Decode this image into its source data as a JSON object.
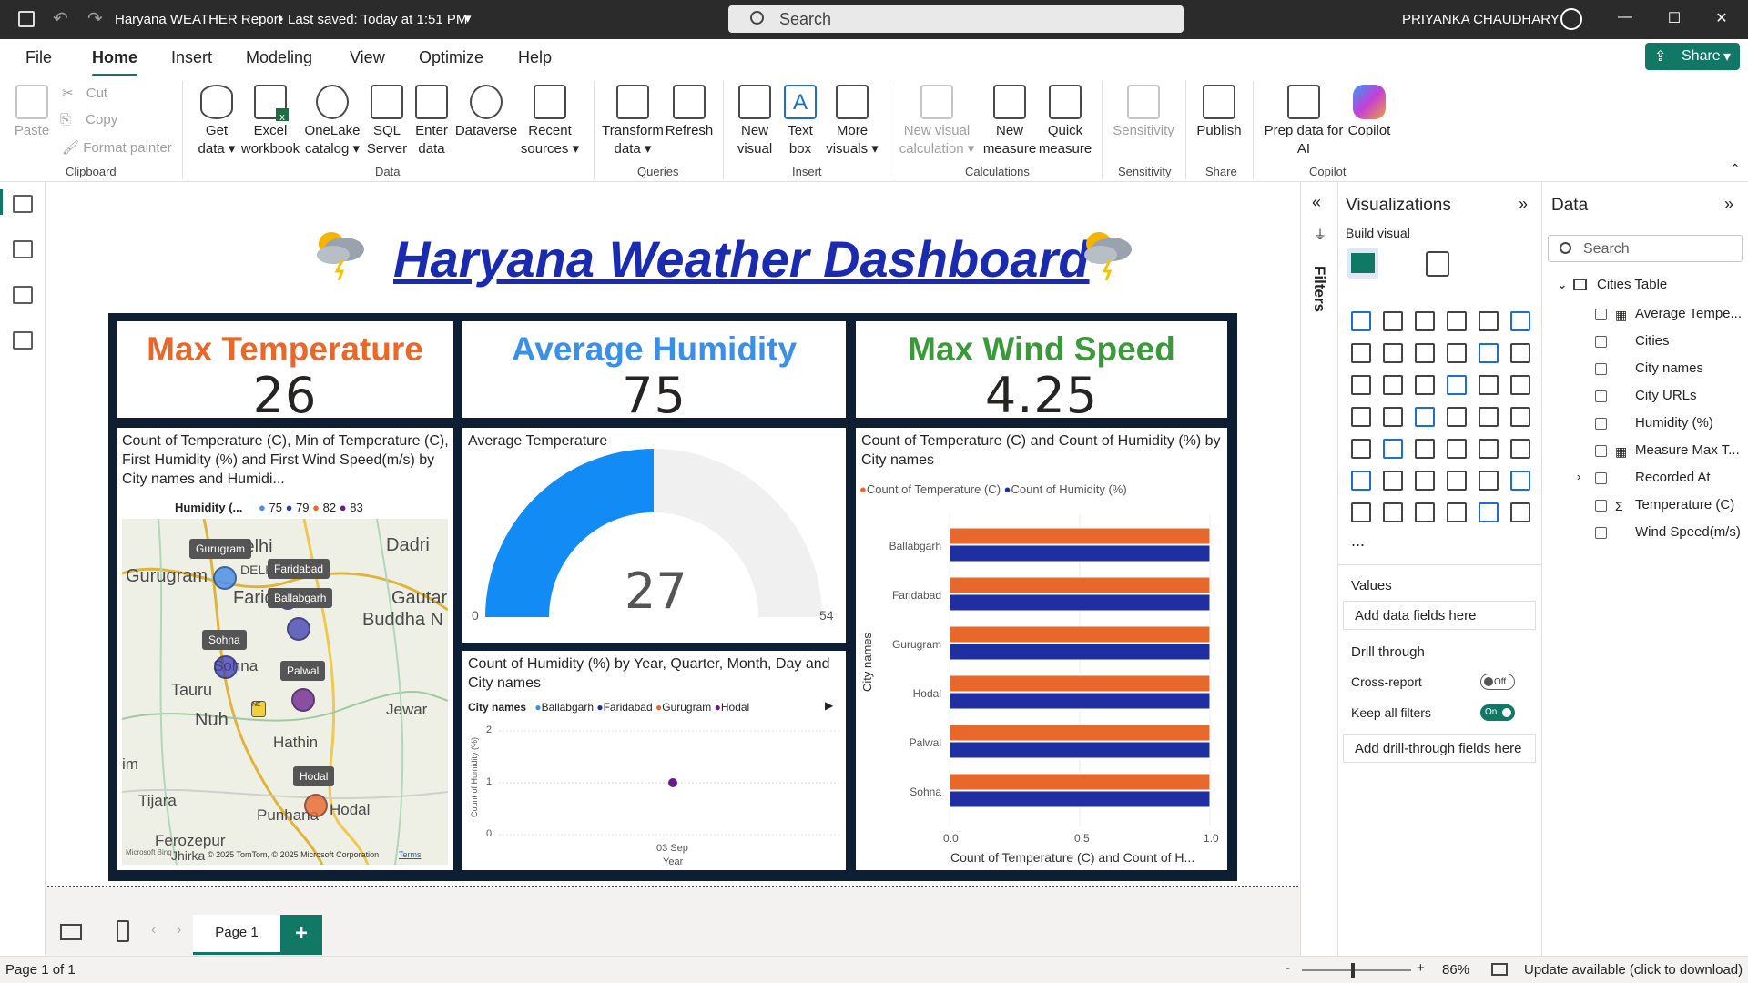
{
  "titlebar": {
    "title": "Haryana WEATHER Report",
    "saved": "Last saved: Today at 1:51 PM",
    "search": "Search",
    "user": "PRIYANKA CHAUDHARY"
  },
  "menu": [
    "File",
    "Home",
    "Insert",
    "Modeling",
    "View",
    "Optimize",
    "Help"
  ],
  "share": "Share",
  "ribbon": {
    "clipboard": {
      "paste": "Paste",
      "cut": "Cut",
      "copy": "Copy",
      "format": "Format painter",
      "group": "Clipboard"
    },
    "data": {
      "get1": "Get",
      "get2": "data",
      "excel1": "Excel",
      "excel2": "workbook",
      "onelake1": "OneLake",
      "onelake2": "catalog",
      "sql1": "SQL",
      "sql2": "Server",
      "enter1": "Enter",
      "enter2": "data",
      "dataverse": "Dataverse",
      "recent1": "Recent",
      "recent2": "sources",
      "group": "Data"
    },
    "queries": {
      "transform1": "Transform",
      "transform2": "data",
      "refresh": "Refresh",
      "group": "Queries"
    },
    "insert": {
      "newvisual1": "New",
      "newvisual2": "visual",
      "text1": "Text",
      "text2": "box",
      "more1": "More",
      "more2": "visuals",
      "group": "Insert"
    },
    "calc": {
      "nvc1": "New visual",
      "nvc2": "calculation",
      "nm1": "New",
      "nm2": "measure",
      "qm1": "Quick",
      "qm2": "measure",
      "group": "Calculations"
    },
    "sens": {
      "label": "Sensitivity",
      "group": "Sensitivity"
    },
    "share": {
      "label": "Publish",
      "group": "Share"
    },
    "copilot": {
      "prep1": "Prep data for",
      "prep2": "AI",
      "copilot": "Copilot",
      "group": "Copilot"
    }
  },
  "dashboard": {
    "title": "Haryana Weather Dashboard ",
    "kpis": [
      {
        "label": "Max Temperature",
        "value": "26",
        "color": "#e8672a"
      },
      {
        "label": "Average Humidity",
        "value": "75",
        "color": "#3a8fe6"
      },
      {
        "label": "Max Wind Speed",
        "value": "4.25",
        "color": "#3a9a3a"
      }
    ],
    "map": {
      "title": "Count of Temperature (C), Min of Temperature (C), First Humidity (%) and First Wind Speed(m/s) by City names and Humidi...",
      "legend_title": "Humidity (...",
      "legend": [
        {
          "label": "75",
          "color": "#4a8fe6"
        },
        {
          "label": "79",
          "color": "#3a3ab0"
        },
        {
          "label": "82",
          "color": "#e8672a"
        },
        {
          "label": "83",
          "color": "#6a1a8a"
        }
      ],
      "places": [
        "Gurugram",
        "Delhi",
        "DELHI",
        "Dadri",
        "Faridab",
        "Gautar",
        "Buddha N",
        "Sohna",
        "Tauru",
        "Nuh",
        "Jewar",
        "Hathin",
        "Tijara",
        "Punhana",
        "Hodal",
        "Ferozepur",
        "Jhirka",
        "im"
      ],
      "cities": [
        {
          "name": "Gurugram",
          "color": "#4a8fe6"
        },
        {
          "name": "Faridabad",
          "color": "#3a3ab0"
        },
        {
          "name": "Ballabgarh",
          "color": "#3a3ab0"
        },
        {
          "name": "Sohna",
          "color": "#3a3ab0"
        },
        {
          "name": "Palwal",
          "color": "#6a1a8a"
        },
        {
          "name": "Hodal",
          "color": "#e8672a"
        }
      ],
      "credit": "© 2025 TomTom, © 2025 Microsoft Corporation",
      "terms": "Terms",
      "brand": "Microsoft Bing"
    },
    "gauge": {
      "title": "Average Temperature",
      "value": 27,
      "min": 0,
      "max": 54,
      "value_label": "27",
      "min_label": "0",
      "max_label": "54"
    },
    "scatter": {
      "title": "Count of Humidity (%) by Year, Quarter, Month, Day and City names",
      "legend_title": "City names",
      "legend": [
        {
          "label": "Ballabgarh",
          "color": "#3a8fe6"
        },
        {
          "label": "Faridabad",
          "color": "#1f2ea0"
        },
        {
          "label": "Gurugram",
          "color": "#e8672a"
        },
        {
          "label": "Hodal",
          "color": "#6a1a8a"
        }
      ],
      "ylabel": "Count of Humidity (%)",
      "xlabel": "Year",
      "xtick": "03 Sep",
      "yticks": [
        "2",
        "1",
        "0"
      ]
    },
    "bars": {
      "title": "Count of Temperature (C) and Count of Humidity (%) by City names",
      "legend": [
        {
          "label": "Count of Temperature (C)",
          "color": "#e8672a"
        },
        {
          "label": "Count of Humidity (%)",
          "color": "#1f2ea0"
        }
      ],
      "ylabel": "City names",
      "xlabel": "Count of Temperature (C) and Count of H...",
      "xticks": [
        "0.0",
        "0.5",
        "1.0"
      ]
    }
  },
  "chart_data": [
    {
      "type": "bar",
      "title": "Count of Temperature (C) and Count of Humidity (%) by City names",
      "categories": [
        "Ballabgarh",
        "Faridabad",
        "Gurugram",
        "Hodal",
        "Palwal",
        "Sohna"
      ],
      "series": [
        {
          "name": "Count of Temperature (C)",
          "values": [
            1,
            1,
            1,
            1,
            1,
            1
          ]
        },
        {
          "name": "Count of Humidity (%)",
          "values": [
            1,
            1,
            1,
            1,
            1,
            1
          ]
        }
      ],
      "xlim": [
        0,
        1
      ],
      "ylabel": "City names",
      "xlabel": "Count of Temperature (C) and Count of H..."
    },
    {
      "type": "scatter",
      "title": "Count of Humidity (%) by Year, Quarter, Month, Day and City names",
      "x": [
        "03 Sep"
      ],
      "series": [
        {
          "name": "Hodal",
          "values": [
            1
          ]
        }
      ],
      "ylim": [
        0,
        2
      ]
    },
    {
      "type": "gauge",
      "title": "Average Temperature",
      "value": 27,
      "min": 0,
      "max": 54
    }
  ],
  "filters": {
    "label": "Filters"
  },
  "viz": {
    "title": "Visualizations",
    "build": "Build visual",
    "values": "Values",
    "add_fields": "Add data fields here",
    "drill": "Drill through",
    "cross": "Cross-report",
    "cross_state": "Off",
    "keep": "Keep all filters",
    "keep_state": "On",
    "add_drill": "Add drill-through fields here",
    "more": "..."
  },
  "data": {
    "title": "Data",
    "search": "Search",
    "table": "Cities Table",
    "fields": [
      "Average Tempe...",
      "Cities",
      "City names",
      "City URLs",
      "Humidity (%)",
      "Measure Max T...",
      "Recorded At",
      "Temperature (C)",
      "Wind Speed(m/s)"
    ]
  },
  "pages": {
    "tab": "Page 1",
    "add": "+"
  },
  "status": {
    "page": "Page 1 of 1",
    "zoom": "86%",
    "update": "Update available (click to download)"
  }
}
